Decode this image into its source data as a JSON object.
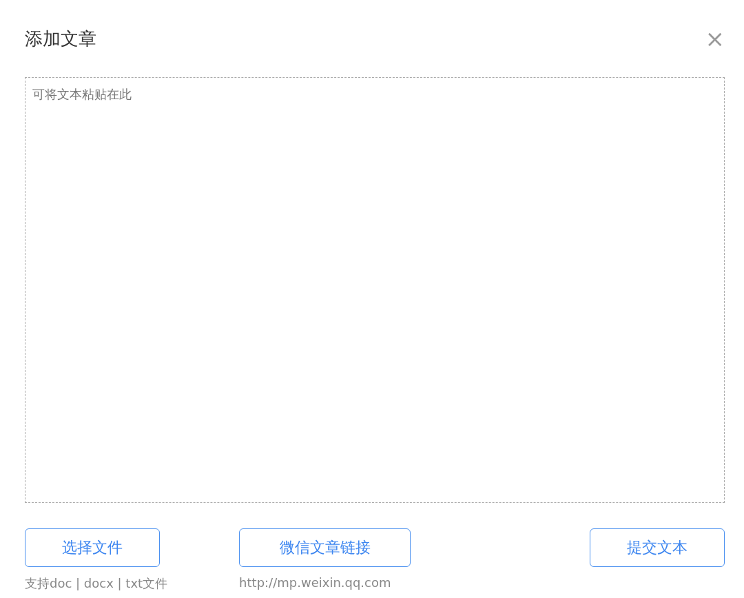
{
  "dialog": {
    "title": "添加文章",
    "close": "×"
  },
  "editor": {
    "placeholder": "可将文本粘贴在此"
  },
  "actions": [
    {
      "label": "选择文件",
      "note": "支持doc | docx | txt文件"
    },
    {
      "label": "微信文章链接",
      "note": "http://mp.weixin.qq.com"
    },
    {
      "label": "提交文本"
    }
  ]
}
